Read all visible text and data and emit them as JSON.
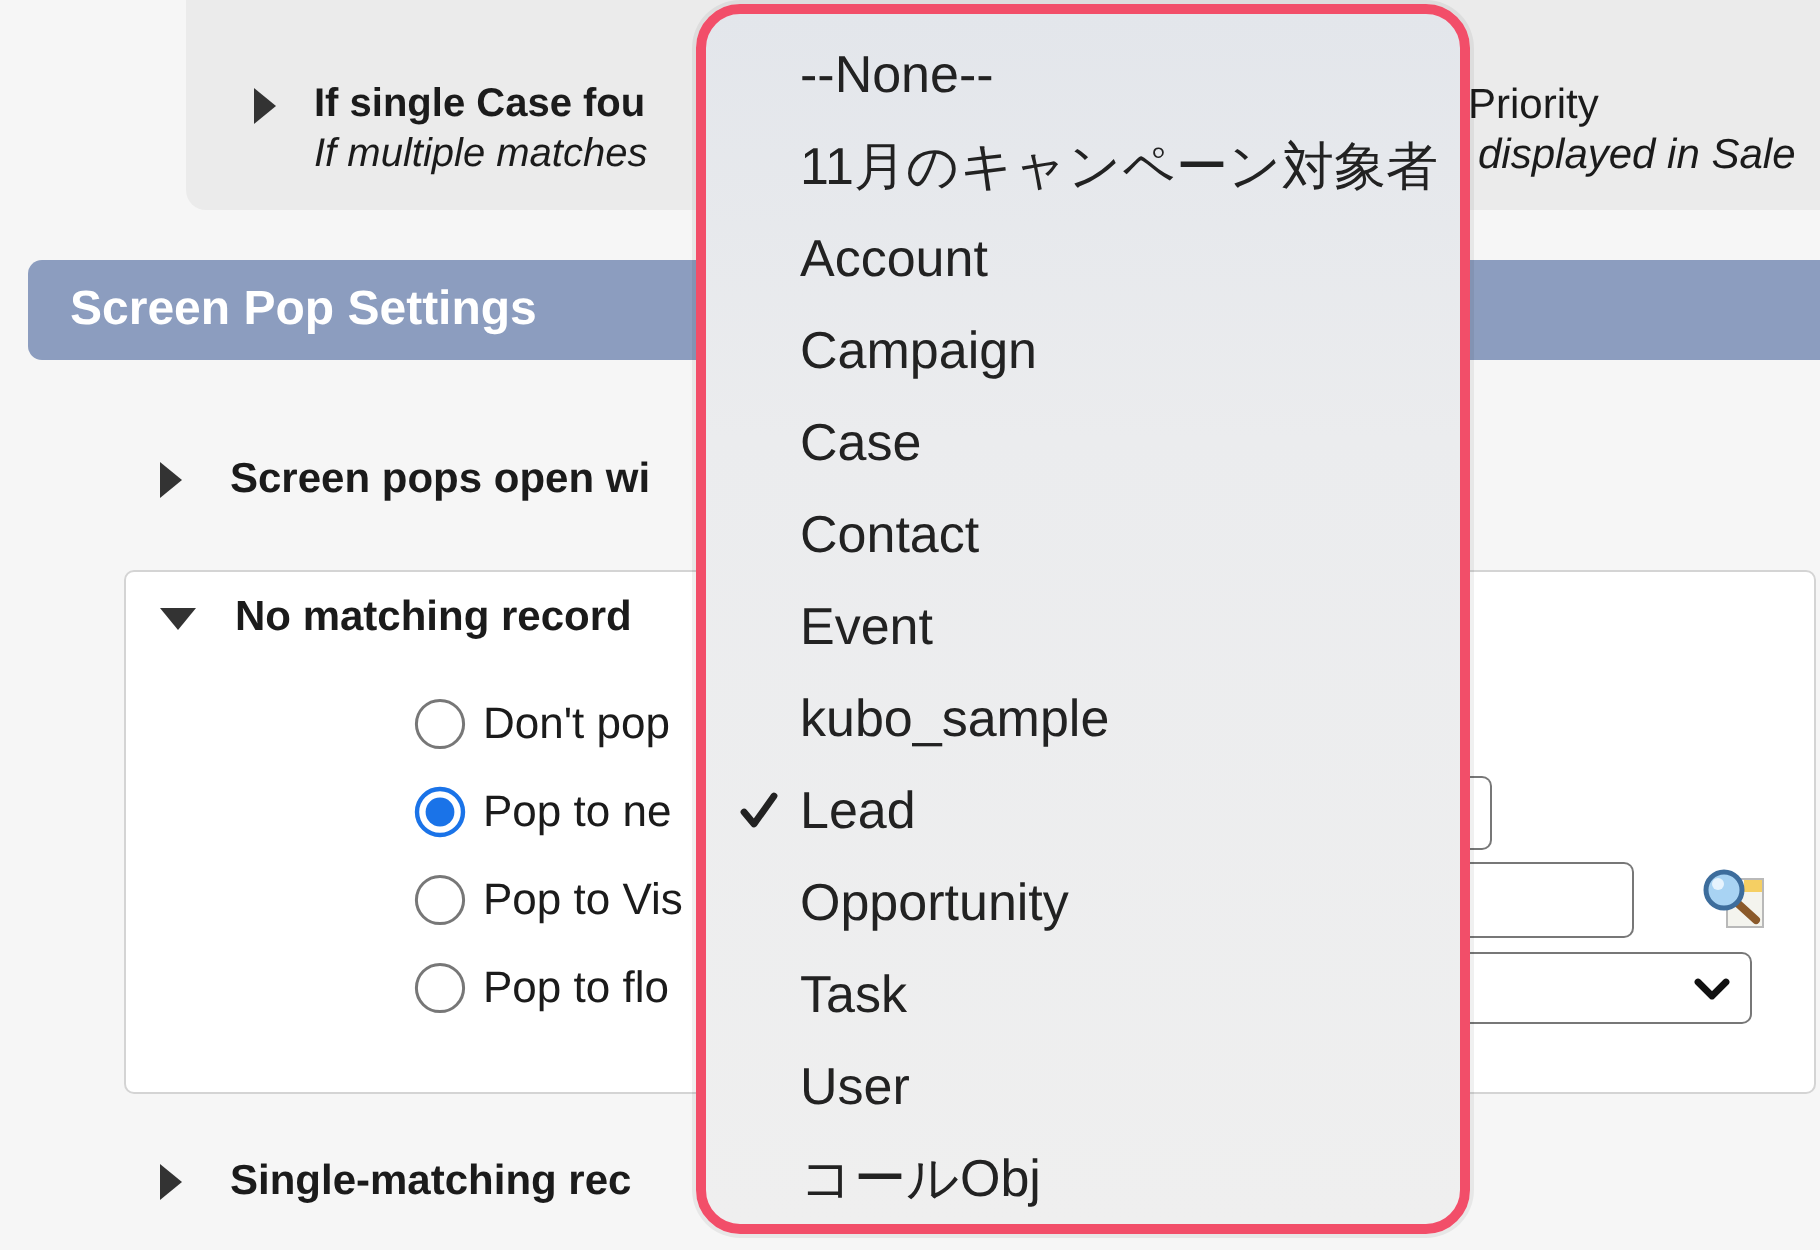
{
  "settings_panel": {
    "expanded": false,
    "title": "If single Case fou",
    "value": "Priority",
    "note": "If multiple matches",
    "note_end": "displayed in Sale"
  },
  "section_header": {
    "title": "Screen Pop Settings"
  },
  "sections": [
    {
      "kind": "row",
      "label": "Screen pops open wi",
      "expanded": false
    },
    {
      "kind": "panel",
      "label": "No matching record",
      "expanded": true,
      "options": [
        {
          "label": "Don't pop",
          "selected": false,
          "kind": "plain"
        },
        {
          "label": "Pop to ne",
          "selected": true,
          "kind": "picklist"
        },
        {
          "label": "Pop to Vis",
          "selected": false,
          "kind": "lookup"
        },
        {
          "label": "Pop to flo",
          "selected": false,
          "kind": "select"
        }
      ]
    },
    {
      "kind": "row",
      "label": "Single-matching rec",
      "expanded": false
    }
  ],
  "dropdown": {
    "items": [
      {
        "label": "--None--",
        "selected": false
      },
      {
        "label": "11月のキャンペーン対象者",
        "selected": false
      },
      {
        "label": "Account",
        "selected": false
      },
      {
        "label": "Campaign",
        "selected": false
      },
      {
        "label": "Case",
        "selected": false
      },
      {
        "label": "Contact",
        "selected": false
      },
      {
        "label": "Event",
        "selected": false
      },
      {
        "label": "kubo_sample",
        "selected": false
      },
      {
        "label": "Lead",
        "selected": true
      },
      {
        "label": "Opportunity",
        "selected": false
      },
      {
        "label": "Task",
        "selected": false
      },
      {
        "label": "User",
        "selected": false
      },
      {
        "label": "コールObj",
        "selected": false
      }
    ]
  }
}
